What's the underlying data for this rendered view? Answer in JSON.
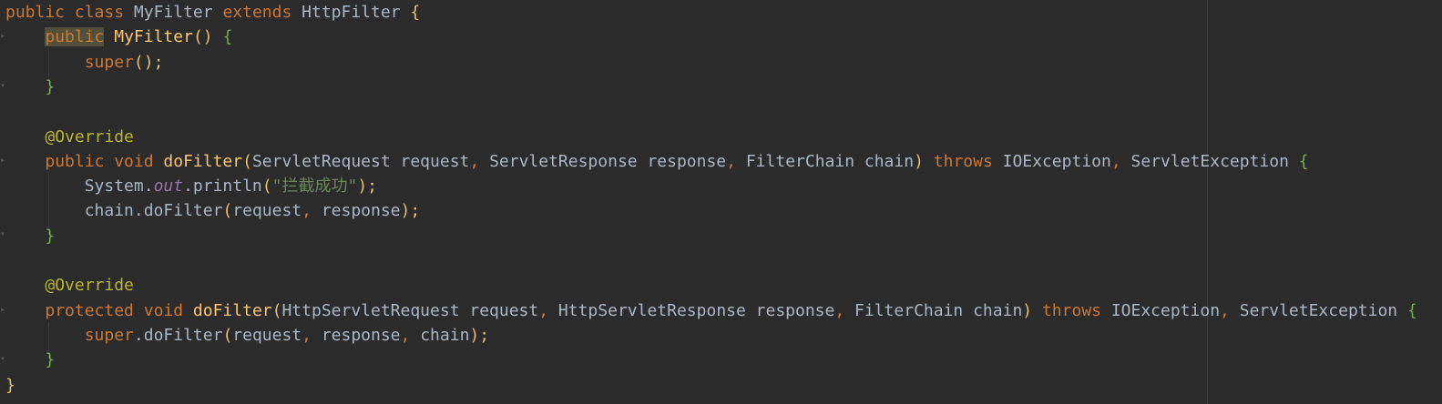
{
  "lines": [
    [
      [
        "public class ",
        "kw"
      ],
      [
        "MyFilter ",
        "plain"
      ],
      [
        "extends ",
        "kw"
      ],
      [
        "HttpFilter ",
        "plain"
      ],
      [
        "{",
        "brace1"
      ]
    ],
    [
      [
        "    ",
        "plain"
      ],
      [
        "public",
        "kw-hl"
      ],
      [
        " ",
        "plain"
      ],
      [
        "MyFilter",
        "method"
      ],
      [
        "() ",
        "paren"
      ],
      [
        "{",
        "brace2"
      ]
    ],
    [
      [
        "        ",
        "plain"
      ],
      [
        "super",
        "kw"
      ],
      [
        "();",
        "paren"
      ]
    ],
    [
      [
        "    ",
        "plain"
      ],
      [
        "}",
        "brace2"
      ]
    ],
    [
      [
        "",
        "plain"
      ]
    ],
    [
      [
        "    ",
        "plain"
      ],
      [
        "@Override",
        "ann"
      ]
    ],
    [
      [
        "    ",
        "plain"
      ],
      [
        "public void ",
        "kw"
      ],
      [
        "doFilter",
        "method"
      ],
      [
        "(",
        "paren"
      ],
      [
        "ServletRequest request",
        "plain"
      ],
      [
        ", ",
        "kw"
      ],
      [
        "ServletResponse response",
        "plain"
      ],
      [
        ", ",
        "kw"
      ],
      [
        "FilterChain chain",
        "plain"
      ],
      [
        ") ",
        "paren"
      ],
      [
        "throws ",
        "kw"
      ],
      [
        "IOException",
        "plain"
      ],
      [
        ", ",
        "kw"
      ],
      [
        "ServletException ",
        "plain"
      ],
      [
        "{",
        "brace2"
      ]
    ],
    [
      [
        "        ",
        "plain"
      ],
      [
        "System.",
        "plain"
      ],
      [
        "out",
        "static"
      ],
      [
        ".println",
        "plain"
      ],
      [
        "(",
        "paren"
      ],
      [
        "\"拦截成功\"",
        "str"
      ],
      [
        ");",
        "paren"
      ]
    ],
    [
      [
        "        ",
        "plain"
      ],
      [
        "chain.doFilter",
        "plain"
      ],
      [
        "(",
        "paren"
      ],
      [
        "request",
        "plain"
      ],
      [
        ", ",
        "kw"
      ],
      [
        "response",
        "plain"
      ],
      [
        ");",
        "paren"
      ]
    ],
    [
      [
        "    ",
        "plain"
      ],
      [
        "}",
        "brace2"
      ]
    ],
    [
      [
        "",
        "plain"
      ]
    ],
    [
      [
        "    ",
        "plain"
      ],
      [
        "@Override",
        "ann"
      ]
    ],
    [
      [
        "    ",
        "plain"
      ],
      [
        "protected void ",
        "kw"
      ],
      [
        "doFilter",
        "method"
      ],
      [
        "(",
        "paren"
      ],
      [
        "HttpServletRequest request",
        "plain"
      ],
      [
        ", ",
        "kw"
      ],
      [
        "HttpServletResponse response",
        "plain"
      ],
      [
        ", ",
        "kw"
      ],
      [
        "FilterChain chain",
        "plain"
      ],
      [
        ") ",
        "paren"
      ],
      [
        "throws ",
        "kw"
      ],
      [
        "IOException",
        "plain"
      ],
      [
        ", ",
        "kw"
      ],
      [
        "ServletException ",
        "plain"
      ],
      [
        "{",
        "brace2"
      ]
    ],
    [
      [
        "        ",
        "plain"
      ],
      [
        "super",
        "kw"
      ],
      [
        ".doFilter",
        "plain"
      ],
      [
        "(",
        "paren"
      ],
      [
        "request",
        "plain"
      ],
      [
        ", ",
        "kw"
      ],
      [
        "response",
        "plain"
      ],
      [
        ", ",
        "kw"
      ],
      [
        "chain",
        "plain"
      ],
      [
        ");",
        "paren"
      ]
    ],
    [
      [
        "    ",
        "plain"
      ],
      [
        "}",
        "brace2"
      ]
    ],
    [
      [
        "}",
        "brace1"
      ]
    ]
  ],
  "colors": {
    "background": "#2b2b2b",
    "keyword": "#cc7832",
    "plain": "#a9b7c6",
    "method": "#ffc66d",
    "annotation": "#bbb529",
    "string": "#6a8759",
    "static_field": "#9876aa",
    "brace_outer": "#e8bf6a",
    "brace_inner": "#6fae4a"
  }
}
